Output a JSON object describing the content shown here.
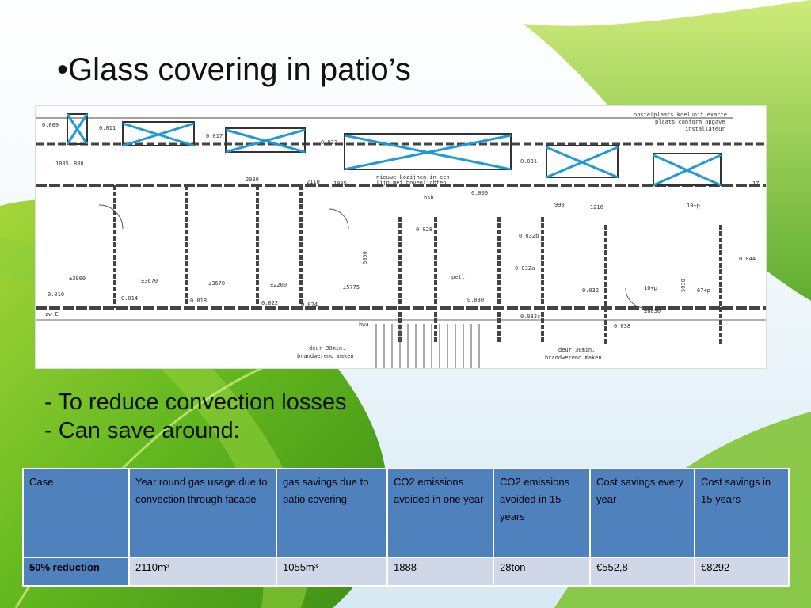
{
  "slide": {
    "title": "•Glass covering in patio’s",
    "bullets": [
      "- To reduce convection losses",
      "- Can save around:"
    ]
  },
  "floor_plan": {
    "labels": [
      "0.009",
      "0.011",
      "0.017",
      "0.023",
      "0.031",
      "0.000",
      "0.028",
      "0.032b",
      "0.032a",
      "0.032",
      "0.038",
      "0.044",
      "0.010",
      "0.014",
      "0.018",
      "0.022",
      "0.024",
      "0.030",
      "0.032c",
      "1035",
      "880",
      "2030",
      "2110",
      "990",
      "1216",
      "1035",
      "±3900",
      "±3670",
      "±3670",
      "±2200",
      "±5775",
      "±6030",
      "5850",
      "5930",
      "deur 30min.",
      "brandwerend maken",
      "deur 30min.",
      "brandwerend maken",
      "opstelplaats koelunit exacte",
      "plaats conform opgave",
      "installateur",
      "nieuwe kozijnen in een",
      "lijn met bovenlichten",
      "10+p",
      "10+p",
      "67+p",
      "pell",
      "bsh",
      "hwa",
      "zw-E",
      "17"
    ]
  },
  "table": {
    "headers": [
      "Case",
      "Year round gas usage due to convection through facade",
      "gas savings due to patio covering",
      "CO2 emissions avoided in one year",
      "CO2 emissions avoided in 15 years",
      "Cost savings every year",
      "Cost savings in 15 years"
    ],
    "rows": [
      [
        "50% reduction",
        "2110m³",
        "1055m³",
        "1888",
        "28ton",
        "€552,8",
        "€8292"
      ]
    ]
  },
  "colors": {
    "header_bg": "#4f81bd",
    "cell_bg": "#d0d8e8",
    "cross_marks": "#1f9ad6"
  }
}
